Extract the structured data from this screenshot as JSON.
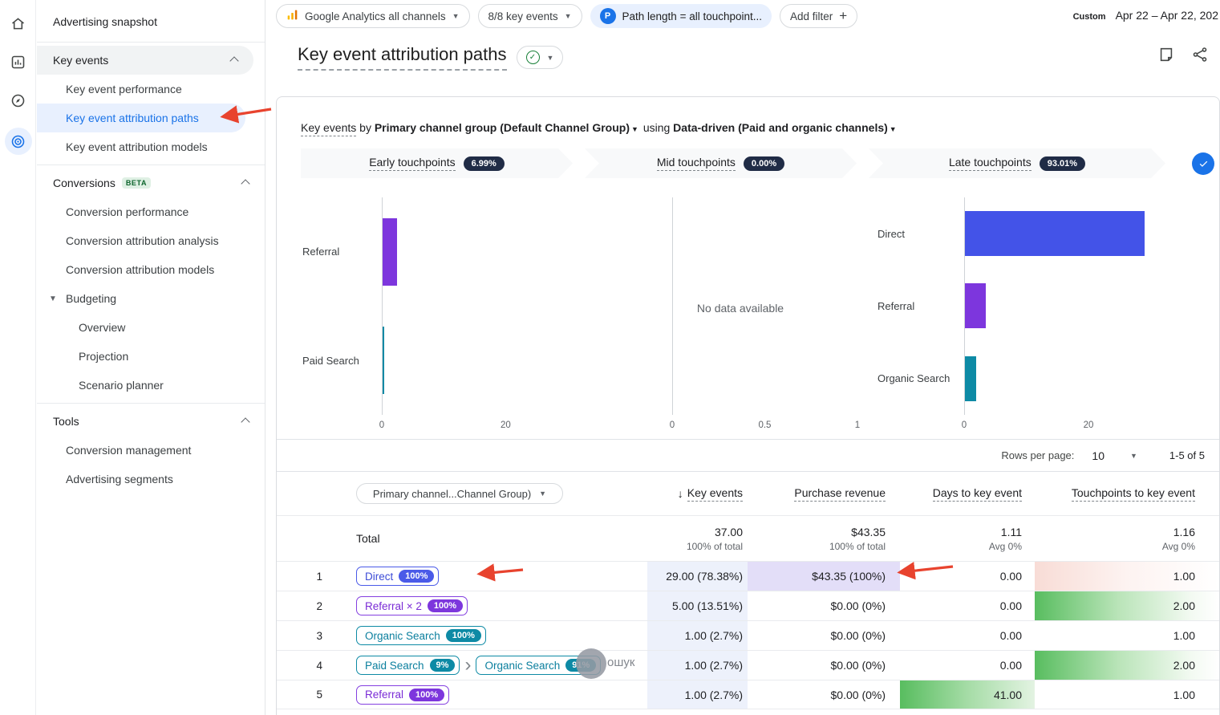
{
  "topbar": {
    "property_selector": "Google Analytics all channels",
    "key_events_selector": "8/8 key events",
    "path_filter_chip": "Path length = all touchpoint...",
    "path_filter_badge": "P",
    "add_filter_label": "Add filter",
    "date_preset": "Custom",
    "date_range": "Apr 22 – Apr 22, 202"
  },
  "sidebar": {
    "snapshot": "Advertising snapshot",
    "key_events_header": "Key events",
    "key_events_items": [
      "Key event performance",
      "Key event attribution paths",
      "Key event attribution models"
    ],
    "conversions_header": "Conversions",
    "conversions_badge": "BETA",
    "conversions_items": [
      "Conversion performance",
      "Conversion attribution analysis",
      "Conversion attribution models"
    ],
    "budgeting_label": "Budgeting",
    "budgeting_items": [
      "Overview",
      "Projection",
      "Scenario planner"
    ],
    "tools_header": "Tools",
    "tools_items": [
      "Conversion management",
      "Advertising segments"
    ]
  },
  "report": {
    "title": "Key event attribution paths",
    "subtitle_metric": "Key events",
    "subtitle_by": "by",
    "subtitle_dimension": "Primary channel group (Default Channel Group)",
    "subtitle_using": "using",
    "subtitle_model": "Data-driven (Paid and organic channels)"
  },
  "tabs": [
    {
      "label": "Early touchpoints",
      "badge": "6.99%"
    },
    {
      "label": "Mid touchpoints",
      "badge": "0.00%"
    },
    {
      "label": "Late touchpoints",
      "badge": "93.01%"
    }
  ],
  "chart_data": [
    {
      "type": "bar",
      "orientation": "horizontal",
      "title": "Early touchpoints",
      "categories": [
        "Referral",
        "Paid Search"
      ],
      "values": [
        2.3,
        0.2
      ],
      "colors": [
        "#7d36dd",
        "#0d8aa5"
      ],
      "xticks": [
        0,
        20
      ],
      "scale_max": 36,
      "xlim": [
        0,
        20
      ]
    },
    {
      "type": "bar",
      "orientation": "horizontal",
      "title": "Mid touchpoints",
      "categories": [],
      "values": [],
      "colors": [],
      "xticks": [
        0,
        0.5,
        1
      ],
      "scale_max": 1.1,
      "xlim": [
        0,
        1
      ],
      "note": "No data available"
    },
    {
      "type": "bar",
      "orientation": "horizontal",
      "title": "Late touchpoints",
      "categories": [
        "Direct",
        "Referral",
        "Organic Search"
      ],
      "values": [
        29,
        3.4,
        1.8
      ],
      "colors": [
        "#4353e8",
        "#7d36dd",
        "#0d8aa5"
      ],
      "xticks": [
        0,
        20
      ],
      "scale_max": 40,
      "xlim": [
        0,
        20
      ]
    }
  ],
  "table": {
    "rows_per_page_label": "Rows per page:",
    "rows_per_page_value": "10",
    "range_label": "1-5 of 5",
    "dimension_selector": "Primary channel...Channel Group)",
    "columns": [
      "Key events",
      "Purchase revenue",
      "Days to key event",
      "Touchpoints to key event"
    ],
    "total": {
      "label": "Total",
      "key_events": "37.00",
      "key_events_sub": "100% of total",
      "revenue": "$43.35",
      "revenue_sub": "100% of total",
      "days": "1.11",
      "days_sub": "Avg 0%",
      "touchpoints": "1.16",
      "touchpoints_sub": "Avg 0%"
    },
    "rows": [
      {
        "num": "1",
        "path": [
          {
            "label": "Direct",
            "pct": "100%",
            "color": "blue"
          }
        ],
        "key_events": "29.00 (78.38%)",
        "revenue": "$43.35 (100%)",
        "days": "0.00",
        "touchpoints": "1.00"
      },
      {
        "num": "2",
        "path": [
          {
            "label": "Referral × 2",
            "pct": "100%",
            "color": "purple"
          }
        ],
        "key_events": "5.00 (13.51%)",
        "revenue": "$0.00 (0%)",
        "days": "0.00",
        "touchpoints": "2.00"
      },
      {
        "num": "3",
        "path": [
          {
            "label": "Organic Search",
            "pct": "100%",
            "color": "teal"
          }
        ],
        "key_events": "1.00 (2.7%)",
        "revenue": "$0.00 (0%)",
        "days": "0.00",
        "touchpoints": "1.00"
      },
      {
        "num": "4",
        "path": [
          {
            "label": "Paid Search",
            "pct": "9%",
            "color": "teal"
          },
          {
            "label": "Organic Search",
            "pct": "91%",
            "color": "teal"
          }
        ],
        "key_events": "1.00 (2.7%)",
        "revenue": "$0.00 (0%)",
        "days": "0.00",
        "touchpoints": "2.00"
      },
      {
        "num": "5",
        "path": [
          {
            "label": "Referral",
            "pct": "100%",
            "color": "purple"
          }
        ],
        "key_events": "1.00 (2.7%)",
        "revenue": "$0.00 (0%)",
        "days": "41.00",
        "touchpoints": "1.00"
      }
    ]
  },
  "annotations": {
    "overlay_text": "ошук",
    "arrow_color": "#e8432e"
  },
  "colors": {
    "accent_blue": "#1a73e8",
    "selected_bg": "#e8f0fe",
    "direct_blue": "#4353e8",
    "referral_purple": "#7d36dd",
    "organic_teal": "#0d8aa5",
    "badge_navy": "#202c46",
    "positive_green": "#58bd5f",
    "annotation_red": "#e8432e"
  }
}
